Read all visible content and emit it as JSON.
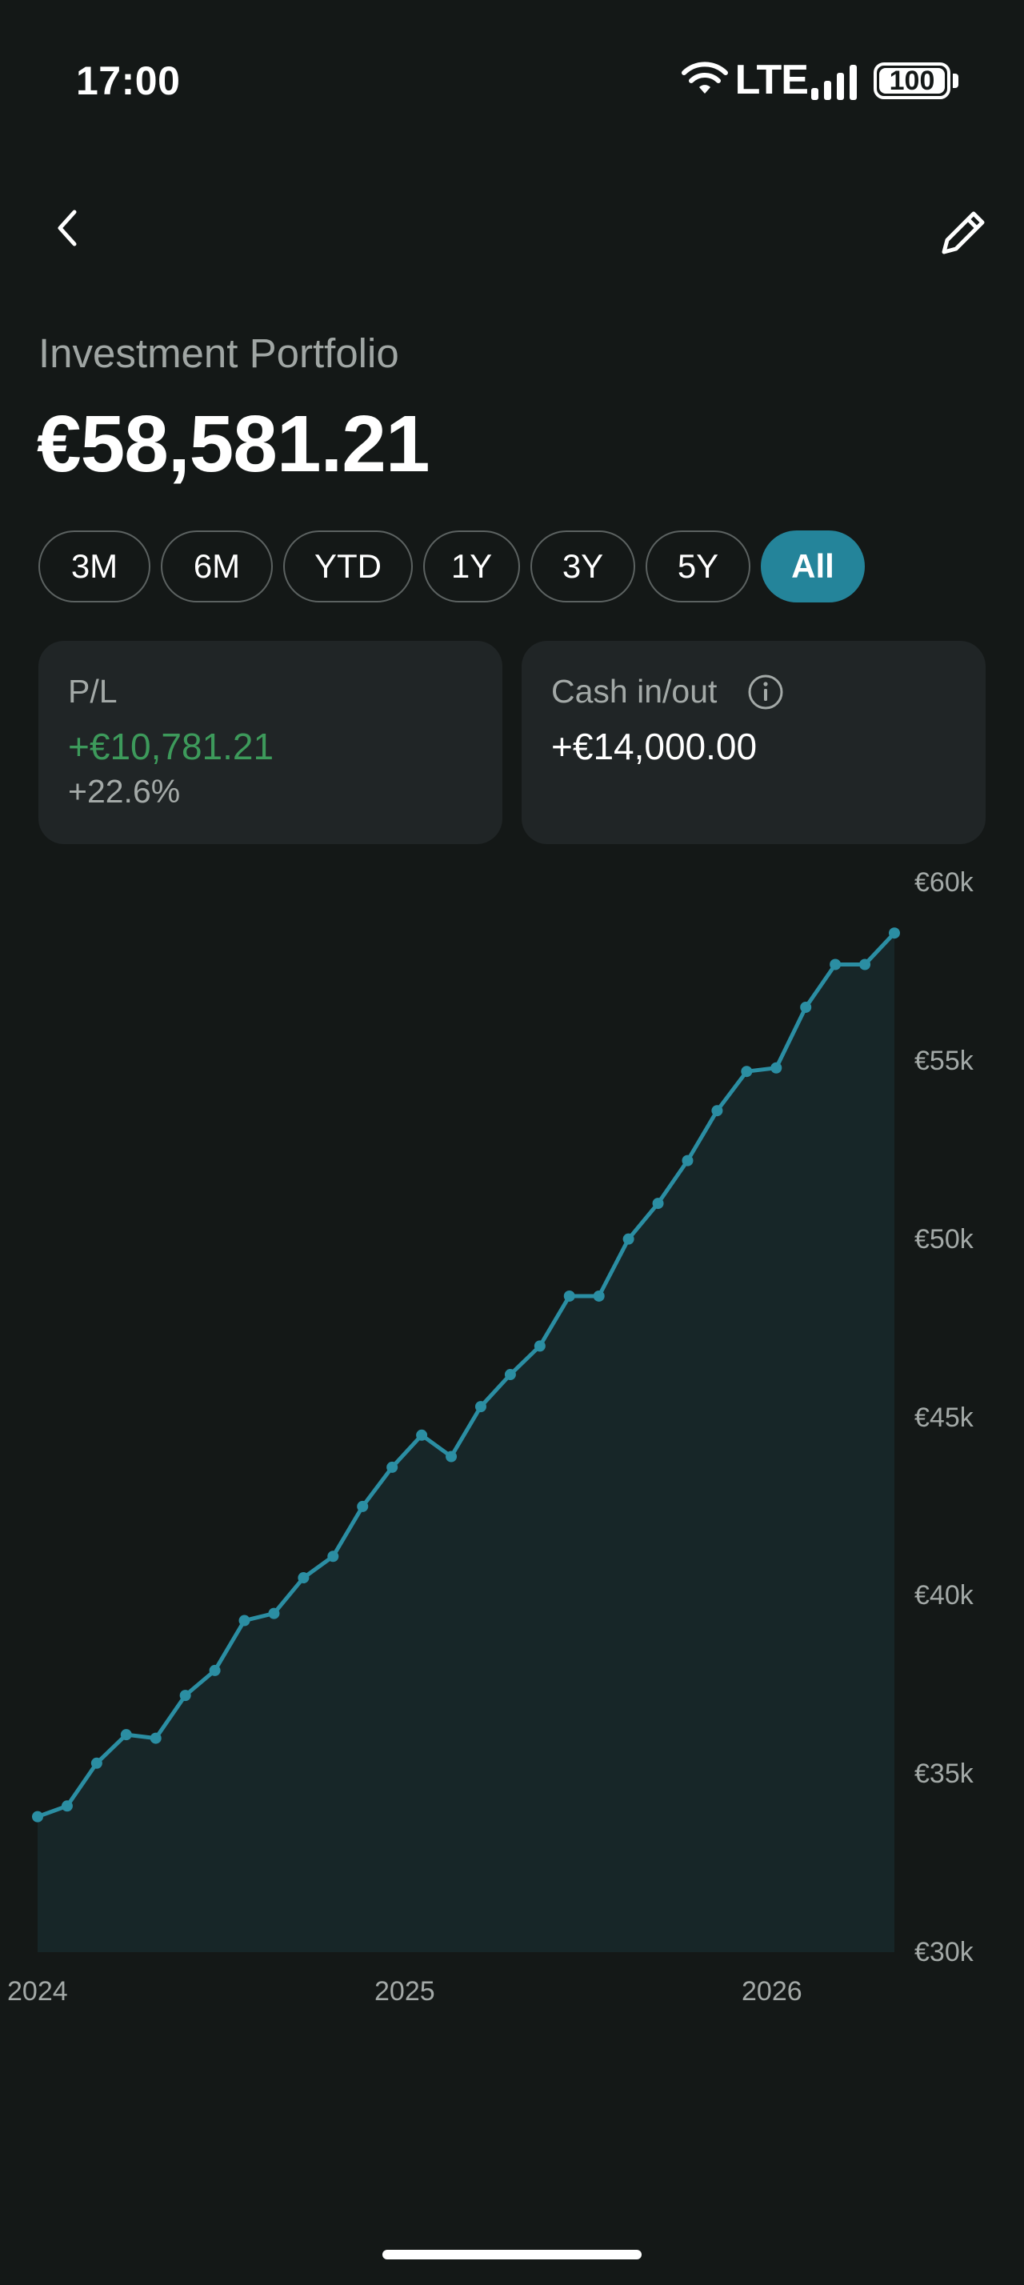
{
  "status_bar": {
    "time": "17:00",
    "network": "LTE",
    "battery": "100",
    "icons": [
      "wifi-icon",
      "signal-icon",
      "battery-icon"
    ]
  },
  "header": {
    "back_icon": "chevron-left-icon",
    "edit_icon": "pencil-icon"
  },
  "portfolio": {
    "title": "Investment Portfolio",
    "value": "€58,581.21"
  },
  "ranges": [
    {
      "label": "3M",
      "active": false
    },
    {
      "label": "6M",
      "active": false
    },
    {
      "label": "YTD",
      "active": false
    },
    {
      "label": "1Y",
      "active": false
    },
    {
      "label": "3Y",
      "active": false
    },
    {
      "label": "5Y",
      "active": false
    },
    {
      "label": "All",
      "active": true
    }
  ],
  "cards": {
    "pl": {
      "label": "P/L",
      "value": "+€10,781.21",
      "percent": "+22.6%"
    },
    "cash": {
      "label": "Cash in/out",
      "value": "+€14,000.00",
      "icon": "info-icon"
    }
  },
  "colors": {
    "accent": "#24849a",
    "line": "#2b8ea3",
    "area": "#172628",
    "positive": "#3d9a5b",
    "background": "#141817",
    "card": "#202526"
  },
  "chart_data": {
    "type": "area",
    "x": [
      "2024-01",
      "2024-02",
      "2024-03",
      "2024-04",
      "2024-05",
      "2024-06",
      "2024-07",
      "2024-08",
      "2024-09",
      "2024-10",
      "2024-11",
      "2024-12",
      "2025-01",
      "2025-02",
      "2025-03",
      "2025-04",
      "2025-05",
      "2025-06",
      "2025-07",
      "2025-08",
      "2025-09",
      "2025-10",
      "2025-11",
      "2025-12",
      "2026-01",
      "2026-02",
      "2026-03",
      "2026-04",
      "2026-05",
      "2026-06"
    ],
    "values": [
      33800,
      34100,
      35300,
      36100,
      36000,
      37200,
      37900,
      39300,
      39500,
      40500,
      41100,
      42500,
      43600,
      44500,
      43900,
      45300,
      46200,
      47000,
      48400,
      48400,
      50000,
      51000,
      52200,
      53600,
      54700,
      54800,
      56500,
      57700,
      57700,
      58581.21
    ],
    "ylim": [
      30000,
      60000
    ],
    "y_ticks": [
      "€60k",
      "€55k",
      "€50k",
      "€45k",
      "€40k",
      "€35k",
      "€30k"
    ],
    "x_ticks": [
      "2024",
      "2025",
      "2026"
    ],
    "grid": false,
    "axis_position": "right"
  }
}
